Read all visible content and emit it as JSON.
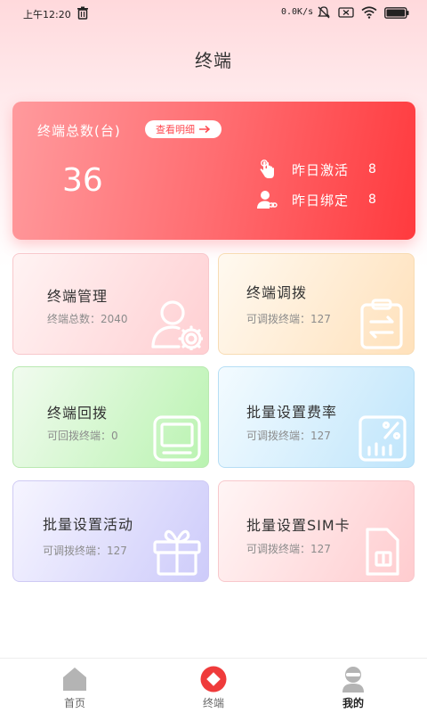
{
  "status_bar": {
    "time": "上午12:20",
    "network_speed": "0.0K/s"
  },
  "header": {
    "title": "终端"
  },
  "summary": {
    "title": "终端总数(台)",
    "detail_button": "查看明细",
    "total": "36",
    "stats": [
      {
        "label": "昨日激活",
        "value": "8",
        "icon": "hand-pointer-icon"
      },
      {
        "label": "昨日绑定",
        "value": "8",
        "icon": "user-link-icon"
      }
    ]
  },
  "cards": [
    {
      "title": "终端管理",
      "subtitle": "终端总数：2040",
      "icon": "user-settings-icon"
    },
    {
      "title": "终端调拨",
      "subtitle": "可调拨终端：127",
      "icon": "clipboard-transfer-icon"
    },
    {
      "title": "终端回拨",
      "subtitle": "可回拨终端：0",
      "icon": "terminal-device-icon"
    },
    {
      "title": "批量设置费率",
      "subtitle": "可调拨终端：127",
      "icon": "rate-percent-icon"
    },
    {
      "title": "批量设置活动",
      "subtitle": "可调拨终端：127",
      "icon": "gift-icon"
    },
    {
      "title": "批量设置SIM卡",
      "subtitle": "可调拨终端：127",
      "icon": "sim-card-icon"
    }
  ],
  "bottom_nav": [
    {
      "label": "首页",
      "icon": "home-icon"
    },
    {
      "label": "终端",
      "icon": "terminal-diamond-icon",
      "active": true
    },
    {
      "label": "我的",
      "icon": "profile-icon"
    }
  ],
  "colors": {
    "accent": "#ff3a3e",
    "card_gradient_start": "#ff9a9d",
    "nav_active": "#ef3b3b"
  }
}
